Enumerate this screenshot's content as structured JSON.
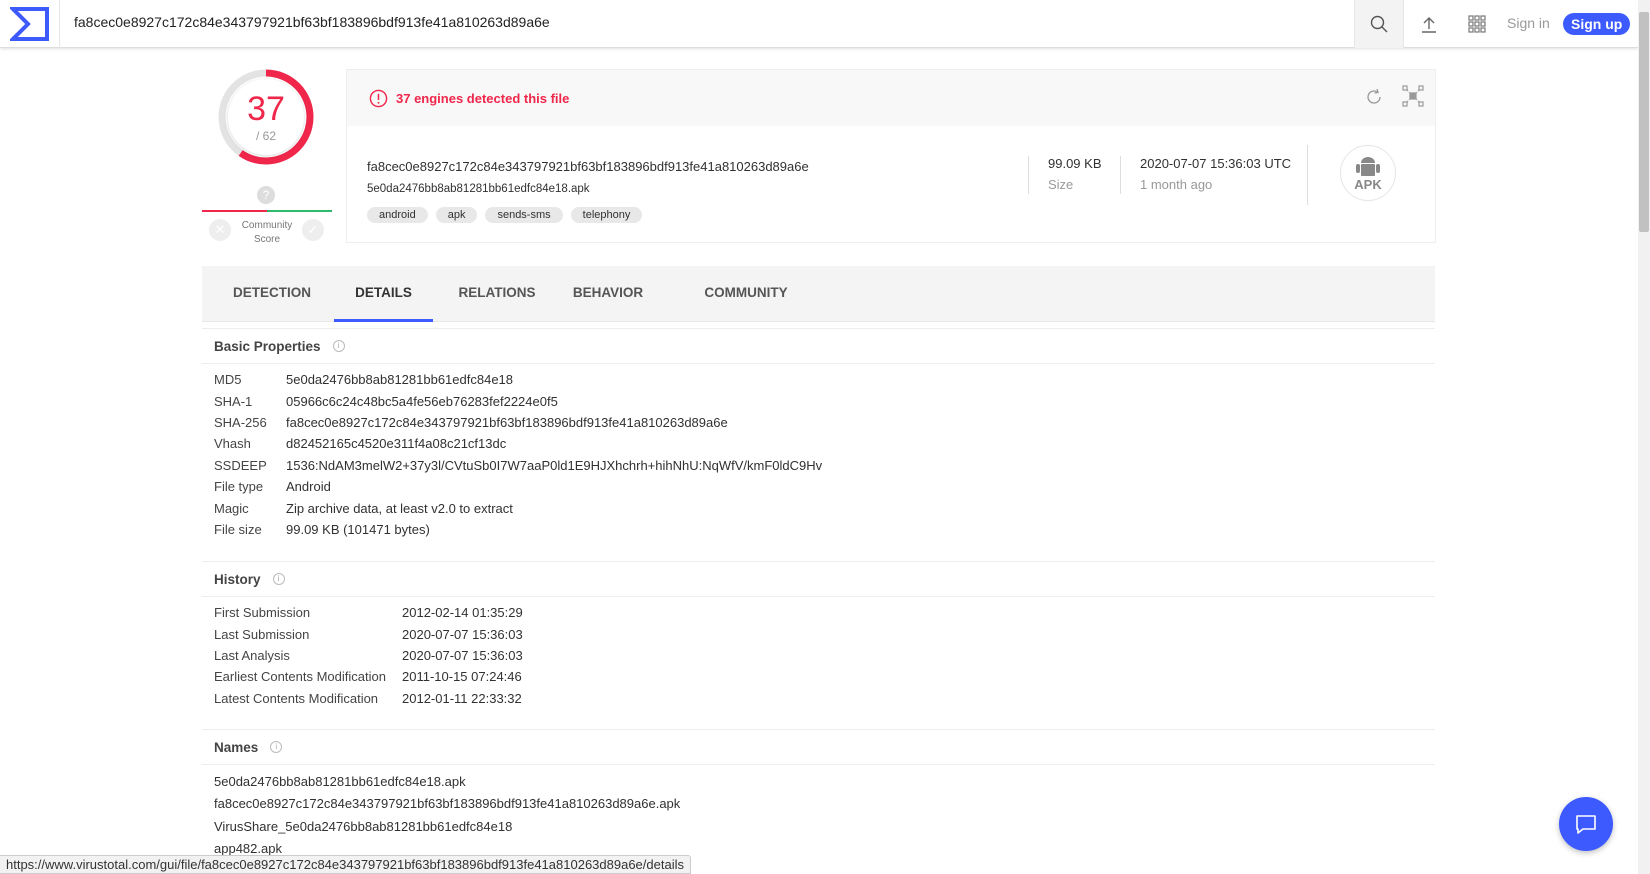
{
  "header": {
    "search_value": "fa8cec0e8927c172c84e343797921bf63bf183896bdf913fe41a810263d89a6e",
    "sign_in": "Sign in",
    "sign_up": "Sign up"
  },
  "score": {
    "detected": "37",
    "total": "/ 62",
    "detected_value": 37,
    "total_value": 62,
    "community_label_1": "Community",
    "community_label_2": "Score",
    "community_question": "?"
  },
  "summary": {
    "alert": "37 engines detected this file",
    "sha256": "fa8cec0e8927c172c84e343797921bf63bf183896bdf913fe41a810263d89a6e",
    "filename": "5e0da2476bb8ab81281bb61edfc84e18.apk",
    "tags": [
      "android",
      "apk",
      "sends-sms",
      "telephony"
    ],
    "size": "99.09 KB",
    "size_label": "Size",
    "date": "2020-07-07 15:36:03 UTC",
    "date_ago": "1 month ago",
    "filetype_badge": "APK"
  },
  "tabs": [
    "DETECTION",
    "DETAILS",
    "RELATIONS",
    "BEHAVIOR",
    "COMMUNITY"
  ],
  "basic": {
    "title": "Basic Properties",
    "rows": [
      [
        "MD5",
        "5e0da2476bb8ab81281bb61edfc84e18"
      ],
      [
        "SHA-1",
        "05966c6c24c48bc5a4fe56eb76283fef2224e0f5"
      ],
      [
        "SHA-256",
        "fa8cec0e8927c172c84e343797921bf63bf183896bdf913fe41a810263d89a6e"
      ],
      [
        "Vhash",
        "d82452165c4520e311f4a08c21cf13dc"
      ],
      [
        "SSDEEP",
        "1536:NdAM3melW2+37y3l/CVtuSb0I7W7aaP0ld1E9HJXhchrh+hihNhU:NqWfV/kmF0ldC9Hv"
      ],
      [
        "File type",
        "Android"
      ],
      [
        "Magic",
        "Zip archive data, at least v2.0 to extract"
      ],
      [
        "File size",
        "99.09 KB (101471 bytes)"
      ]
    ]
  },
  "history": {
    "title": "History",
    "rows": [
      [
        "First Submission",
        "2012-02-14 01:35:29"
      ],
      [
        "Last Submission",
        "2020-07-07 15:36:03"
      ],
      [
        "Last Analysis",
        "2020-07-07 15:36:03"
      ],
      [
        "Earliest Contents Modification",
        "2011-10-15 07:24:46"
      ],
      [
        "Latest Contents Modification",
        "2012-01-11 22:33:32"
      ]
    ]
  },
  "names": {
    "title": "Names",
    "items": [
      "5e0da2476bb8ab81281bb61edfc84e18.apk",
      "fa8cec0e8927c172c84e343797921bf63bf183896bdf913fe41a810263d89a6e.apk",
      "VirusShare_5e0da2476bb8ab81281bb61edfc84e18",
      "app482.apk"
    ]
  },
  "status_url": "https://www.virustotal.com/gui/file/fa8cec0e8927c172c84e343797921bf63bf183896bdf913fe41a810263d89a6e/details",
  "colors": {
    "accent": "#3d5afe",
    "danger": "#f0264b",
    "good": "#2dba6f"
  }
}
